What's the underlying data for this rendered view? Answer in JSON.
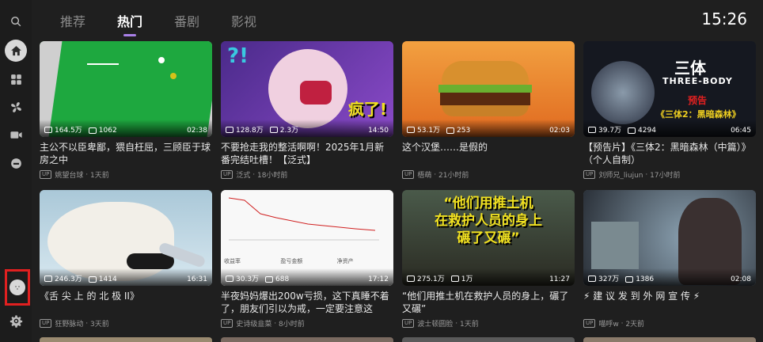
{
  "tabs": [
    "推荐",
    "热门",
    "番剧",
    "影视"
  ],
  "active_tab": 1,
  "clock": "15:26",
  "sidebar": {
    "icons": [
      "search-icon",
      "home-icon",
      "grid-icon",
      "fan-icon",
      "video-icon",
      "circle-icon"
    ],
    "settings_icon": "gear-icon",
    "avatar_icon": "avatar-icon"
  },
  "videos": [
    {
      "views": "164.5万",
      "danmaku": "1062",
      "duration": "02:38",
      "title": "主公不以臣卑鄙，猥自枉屈，三顾臣于球房之中",
      "uploader": "姚望台球",
      "time": "1天前",
      "thumb_color": "#1b9e3a"
    },
    {
      "views": "128.8万",
      "danmaku": "2.3万",
      "duration": "14:50",
      "title": "不要抢走我的整活啊啊！2025年1月新番完结吐槽！【泛式】",
      "uploader": "泛式",
      "time": "18小时前",
      "thumb_color": "#6b3aa8"
    },
    {
      "views": "53.1万",
      "danmaku": "253",
      "duration": "02:03",
      "title": "这个汉堡……是假的",
      "uploader": "梧萌",
      "time": "21小时前",
      "thumb_color": "#c0702a"
    },
    {
      "views": "39.7万",
      "danmaku": "4294",
      "duration": "06:45",
      "title": "【预告片】《三体2：黑暗森林（中篇）》（个人自制）",
      "uploader": "刘师兄_liujun",
      "time": "17小时前",
      "thumb_color": "#1a1f2a"
    },
    {
      "views": "246.3万",
      "danmaku": "1414",
      "duration": "16:31",
      "title": "《舌 尖 上 的 北 极 II》",
      "uploader": "狂野脉动",
      "time": "3天前",
      "thumb_color": "#8ab0c8"
    },
    {
      "views": "30.3万",
      "danmaku": "688",
      "duration": "17:12",
      "title": "半夜妈妈爆出200w亏损，这下真睡不着了，朋友们引以为戒，一定要注意这",
      "uploader": "史诗级韭菜",
      "time": "8小时前",
      "thumb_color": "#f4f4f4"
    },
    {
      "views": "275.1万",
      "danmaku": "1万",
      "duration": "11:27",
      "title": "“他们用推土机在救护人员的身上，碾了又碾”",
      "uploader": "波士顿圆脸",
      "time": "1天前",
      "thumb_color": "#3a4a3a"
    },
    {
      "views": "327万",
      "danmaku": "1386",
      "duration": "02:08",
      "title": "⚡ 建 议 发 到 外 网 宣 传 ⚡",
      "uploader": "喵呼w",
      "time": "2天前",
      "thumb_color": "#6a7d8a"
    }
  ],
  "thumb_text": {
    "v2": "疯了!",
    "v4_line1": "三体",
    "v4_line2": "THREE-BODY",
    "v4_line3": "预告",
    "v4_line4": "《三体2：黑暗森林》",
    "v6_tab1": "收益率",
    "v6_tab2": "盈亏金额",
    "v6_tab3": "净资产",
    "v7_line1": "“他们用推土机",
    "v7_line2": "在救护人员的身上",
    "v7_line3": "碾了又碾”"
  },
  "up_badge": "UP"
}
